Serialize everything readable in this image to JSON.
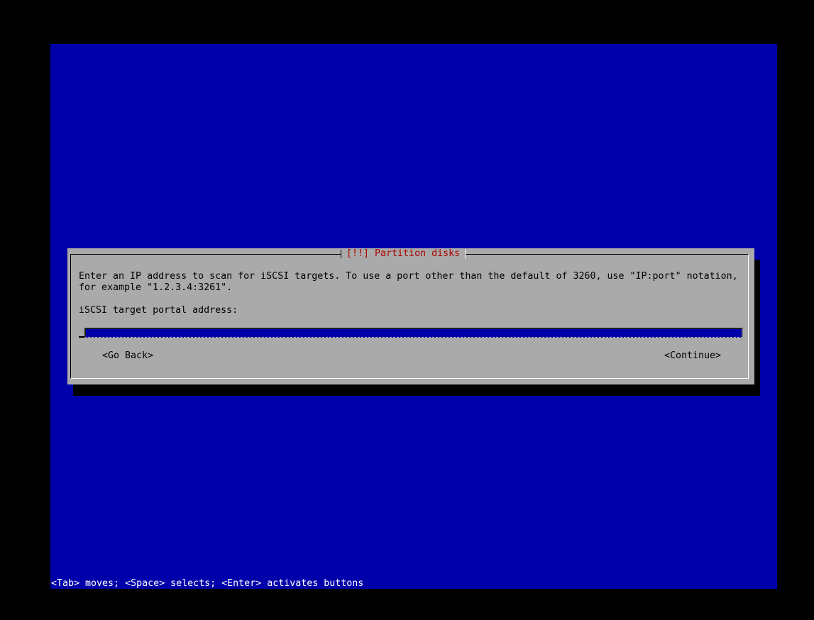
{
  "dialog": {
    "title": "[!!] Partition disks",
    "prompt_line1": "Enter an IP address to scan for iSCSI targets. To use a port other than the default of 3260, use \"IP:port\" notation,",
    "prompt_line2": "for example \"1.2.3.4:3261\".",
    "field_label": "iSCSI target portal address:",
    "field_value": "",
    "back_label": "<Go Back>",
    "continue_label": "<Continue>"
  },
  "help": {
    "text": "<Tab> moves; <Space> selects; <Enter> activates buttons"
  },
  "colors": {
    "screen_background": "#0000aa",
    "dialog_background": "#aaaaaa",
    "title_color": "#aa0000",
    "input_background": "#0000aa",
    "help_text_color": "#ffffff"
  }
}
